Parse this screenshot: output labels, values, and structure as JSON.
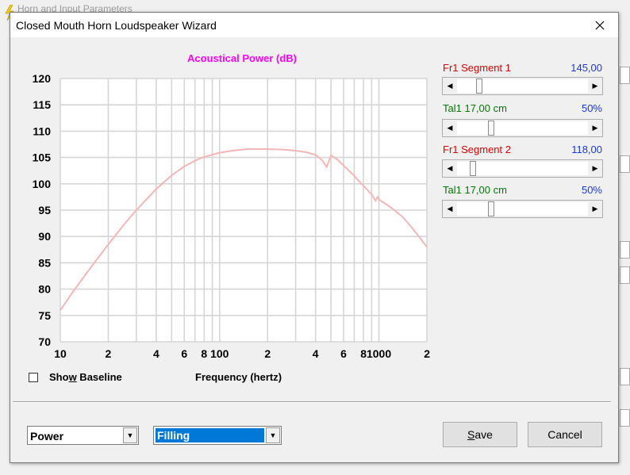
{
  "background_window": {
    "title": "Horn and Input Parameters"
  },
  "dialog": {
    "title": "Closed Mouth Horn Loudspeaker Wizard",
    "close_glyph": "✕"
  },
  "controls": {
    "show_baseline": {
      "label_pre": "Sho",
      "label_accel": "w",
      "label_post": " Baseline",
      "checked": false
    },
    "sliders": [
      {
        "label": "Fr1  Segment 1",
        "value": "145,00",
        "label_color": "#e00000",
        "position_fraction": 0.15
      },
      {
        "label": "Tal1  17,00 cm",
        "value": "50%",
        "label_color": "#007a00",
        "position_fraction": 0.25
      },
      {
        "label": "Fr1  Segment 2",
        "value": "118,00",
        "label_color": "#e00000",
        "position_fraction": 0.1
      },
      {
        "label": "Tal1  17,00 cm",
        "value": "50%",
        "label_color": "#007a00",
        "position_fraction": 0.25
      }
    ],
    "left_arrow": "◀",
    "right_arrow": "▶",
    "mode_select": {
      "value": "Power"
    },
    "filling_select": {
      "value": "Filling"
    },
    "dropdown_glyph": "▼",
    "save_button": {
      "pre": "",
      "accel": "S",
      "post": "ave"
    },
    "cancel_button": {
      "label": "Cancel"
    }
  },
  "chart_data": {
    "type": "line",
    "title": "Acoustical Power (dB)",
    "xlabel": "Frequency (hertz)",
    "ylabel": "",
    "x_scale": "log",
    "xlim": [
      10,
      2000
    ],
    "ylim": [
      70,
      120
    ],
    "y_ticks": [
      120,
      115,
      110,
      105,
      100,
      95,
      90,
      85,
      80,
      75,
      70
    ],
    "x_ticks": [
      {
        "value": 10,
        "label": "10"
      },
      {
        "value": 20,
        "label": "2"
      },
      {
        "value": 40,
        "label": "4"
      },
      {
        "value": 60,
        "label": "6"
      },
      {
        "value": 80,
        "label": "8"
      },
      {
        "value": 100,
        "label": "100"
      },
      {
        "value": 200,
        "label": "2"
      },
      {
        "value": 400,
        "label": "4"
      },
      {
        "value": 600,
        "label": "6"
      },
      {
        "value": 800,
        "label": "8"
      },
      {
        "value": 1000,
        "label": "1000"
      },
      {
        "value": 2000,
        "label": "2"
      }
    ],
    "grid": true,
    "series": [
      {
        "color": "#f4b6b6",
        "x": [
          10,
          12,
          15,
          20,
          25,
          30,
          40,
          50,
          60,
          70,
          80,
          100,
          120,
          150,
          200,
          250,
          300,
          350,
          400,
          440,
          470,
          500,
          550,
          600,
          700,
          800,
          900,
          950,
          980,
          1000,
          1100,
          1200,
          1400,
          1600,
          1800,
          2000
        ],
        "y": [
          76,
          79.5,
          83.5,
          88.5,
          92.2,
          95,
          99,
          101.6,
          103.3,
          104.4,
          105.1,
          105.9,
          106.3,
          106.6,
          106.6,
          106.5,
          106.3,
          106,
          105.5,
          104.5,
          103.2,
          105.4,
          104.6,
          103.5,
          101.5,
          99.6,
          98,
          96.8,
          97.5,
          97,
          96.2,
          95.4,
          93.8,
          91.8,
          89.8,
          88
        ]
      }
    ]
  }
}
